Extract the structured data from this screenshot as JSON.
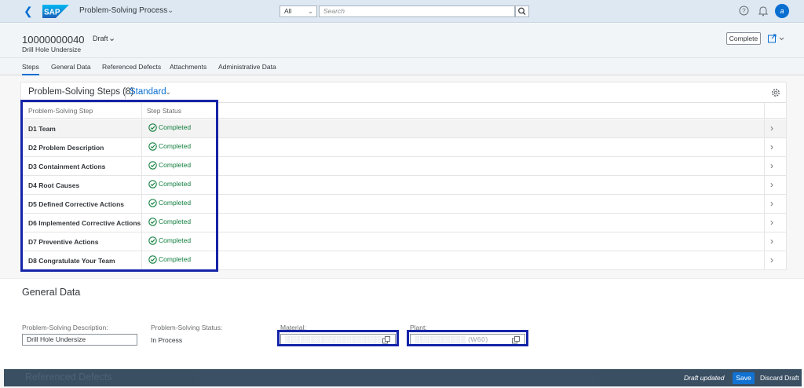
{
  "shell": {
    "logo_text": "SAP",
    "app_title": "Problem-Solving Process",
    "search_scope": "All",
    "search_placeholder": "Search",
    "avatar_initial": "a",
    "colors": {
      "bar_bg": "#dde8f3",
      "brand_blue": "#0a6ed1"
    }
  },
  "header": {
    "object_id": "10000000040",
    "status": "Draft",
    "subtitle": "Drill Hole Undersize",
    "complete_label": "Complete"
  },
  "tabs": [
    {
      "label": "Steps"
    },
    {
      "label": "General Data"
    },
    {
      "label": "Referenced Defects"
    },
    {
      "label": "Attachments"
    },
    {
      "label": "Administrative Data"
    }
  ],
  "steps": {
    "title": "Problem-Solving Steps (8)",
    "variant": "Standard",
    "columns": [
      "Problem-Solving Step",
      "Step Status"
    ],
    "rows": [
      {
        "step": "D1 Team",
        "status": "Completed"
      },
      {
        "step": "D2 Problem Description",
        "status": "Completed"
      },
      {
        "step": "D3 Containment Actions",
        "status": "Completed"
      },
      {
        "step": "D4 Root Causes",
        "status": "Completed"
      },
      {
        "step": "D5 Defined Corrective Actions",
        "status": "Completed"
      },
      {
        "step": "D6 Implemented Corrective Actions",
        "status": "Completed"
      },
      {
        "step": "D7 Preventive Actions",
        "status": "Completed"
      },
      {
        "step": "D8 Congratulate Your Team",
        "status": "Completed"
      }
    ],
    "status_color": "#107e3e"
  },
  "general_data": {
    "title": "General Data",
    "description_label": "Problem-Solving Description:",
    "description_value": "Drill Hole Undersize",
    "status_label": "Problem-Solving Status:",
    "status_value": "In Process",
    "material_label": "Material:",
    "material_value": "░░░░░░░░░░░░░░░░░░░",
    "plant_label": "Plant:",
    "plant_value": "░░░░░░░░░░ (W60)"
  },
  "next_section_title": "Referenced Defects",
  "footer": {
    "message": "Draft updated",
    "save_label": "Save",
    "discard_label": "Discard Draft",
    "highlight_color": "#1524a8"
  }
}
